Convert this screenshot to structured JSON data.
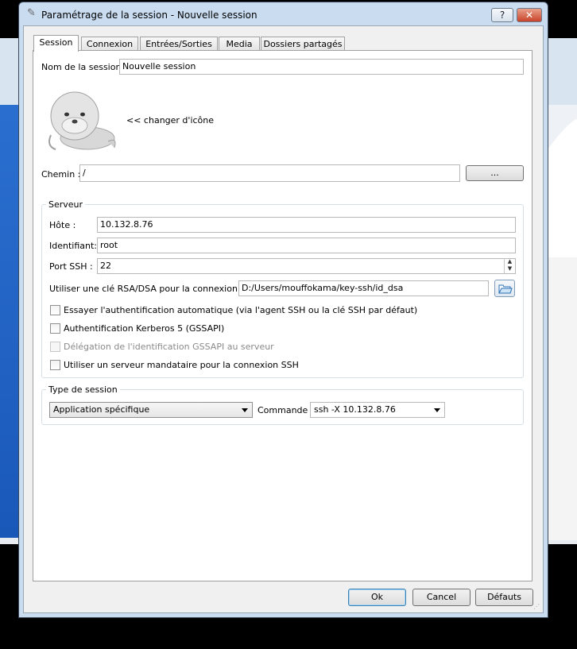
{
  "window": {
    "title": "Paramétrage de la session - Nouvelle session",
    "help_label": "?",
    "close_label": "✕"
  },
  "tabs": [
    {
      "label": "Session"
    },
    {
      "label": "Connexion"
    },
    {
      "label": "Entrées/Sorties"
    },
    {
      "label": "Media"
    },
    {
      "label": "Dossiers partagés"
    }
  ],
  "session": {
    "name_label": "Nom de la session :",
    "name_value": "Nouvelle session",
    "change_icon_label": "<< changer d'icône",
    "path_label": "Chemin :",
    "path_value": "/",
    "browse_label": "..."
  },
  "server": {
    "group_title": "Serveur",
    "host_label": "Hôte :",
    "host_value": "10.132.8.76",
    "login_label": "Identifiant:",
    "login_value": "root",
    "port_label": "Port SSH :",
    "port_value": "22",
    "key_label": "Utiliser une clé RSA/DSA pour la connexion SSH :",
    "key_value": "D:/Users/mouffokama/key-ssh/id_dsa",
    "options": [
      {
        "label": "Essayer l'authentification automatique (via l'agent SSH ou la clé SSH par défaut)",
        "checked": false,
        "enabled": true
      },
      {
        "label": "Authentification Kerberos 5 (GSSAPI)",
        "checked": false,
        "enabled": true
      },
      {
        "label": "Délégation de l'identification GSSAPI au serveur",
        "checked": false,
        "enabled": false
      },
      {
        "label": "Utiliser un serveur mandataire pour la connexion SSH",
        "checked": false,
        "enabled": true
      }
    ]
  },
  "session_type": {
    "group_title": "Type de session",
    "type_value": "Application spécifique",
    "command_label": "Commande :",
    "command_value": "ssh -X 10.132.8.76"
  },
  "footer": {
    "ok_label": "Ok",
    "cancel_label": "Cancel",
    "defaults_label": "Défauts"
  },
  "icons": {
    "title": "pencil-icon",
    "session": "seal-icon",
    "key_browse": "folder-open-icon"
  }
}
